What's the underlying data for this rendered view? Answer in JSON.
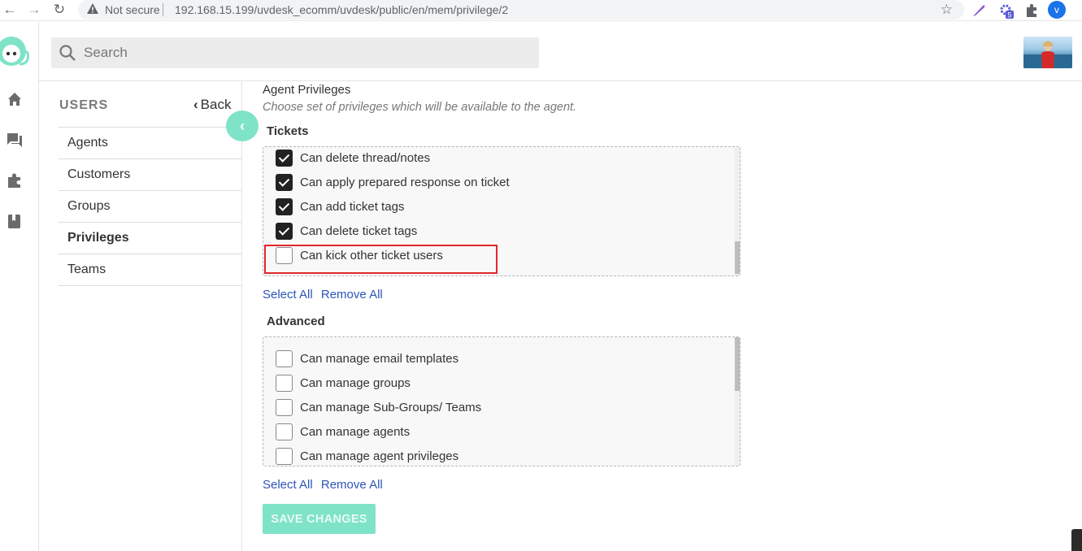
{
  "browser": {
    "security_label": "Not secure",
    "url": "192.168.15.199/uvdesk_ecomm/uvdesk/public/en/mem/privilege/2",
    "extension_badge": "5",
    "profile_initial": "v"
  },
  "header": {
    "search_placeholder": "Search"
  },
  "subnav": {
    "title": "USERS",
    "back_label": "Back",
    "items": [
      {
        "label": "Agents",
        "active": false
      },
      {
        "label": "Customers",
        "active": false
      },
      {
        "label": "Groups",
        "active": false
      },
      {
        "label": "Privileges",
        "active": true
      },
      {
        "label": "Teams",
        "active": false
      }
    ]
  },
  "main": {
    "section_title": "Agent Privileges",
    "section_desc": "Choose set of privileges which will be available to the agent.",
    "groups": [
      {
        "title": "Tickets",
        "items": [
          {
            "label": "Can delete thread/notes",
            "checked": true
          },
          {
            "label": "Can apply prepared response on ticket",
            "checked": true
          },
          {
            "label": "Can add ticket tags",
            "checked": true
          },
          {
            "label": "Can delete ticket tags",
            "checked": true
          },
          {
            "label": "Can kick other ticket users",
            "checked": false
          }
        ],
        "select_all": "Select All",
        "remove_all": "Remove All"
      },
      {
        "title": "Advanced",
        "items": [
          {
            "label": "Can manage email templates",
            "checked": false
          },
          {
            "label": "Can manage groups",
            "checked": false
          },
          {
            "label": "Can manage Sub-Groups/ Teams",
            "checked": false
          },
          {
            "label": "Can manage agents",
            "checked": false
          },
          {
            "label": "Can manage agent privileges",
            "checked": false
          }
        ],
        "select_all": "Select All",
        "remove_all": "Remove All"
      }
    ],
    "save_label": "SAVE CHANGES"
  },
  "colors": {
    "accent": "#7fe3c7",
    "link": "#2c55b8",
    "highlight": "#e0262e"
  }
}
